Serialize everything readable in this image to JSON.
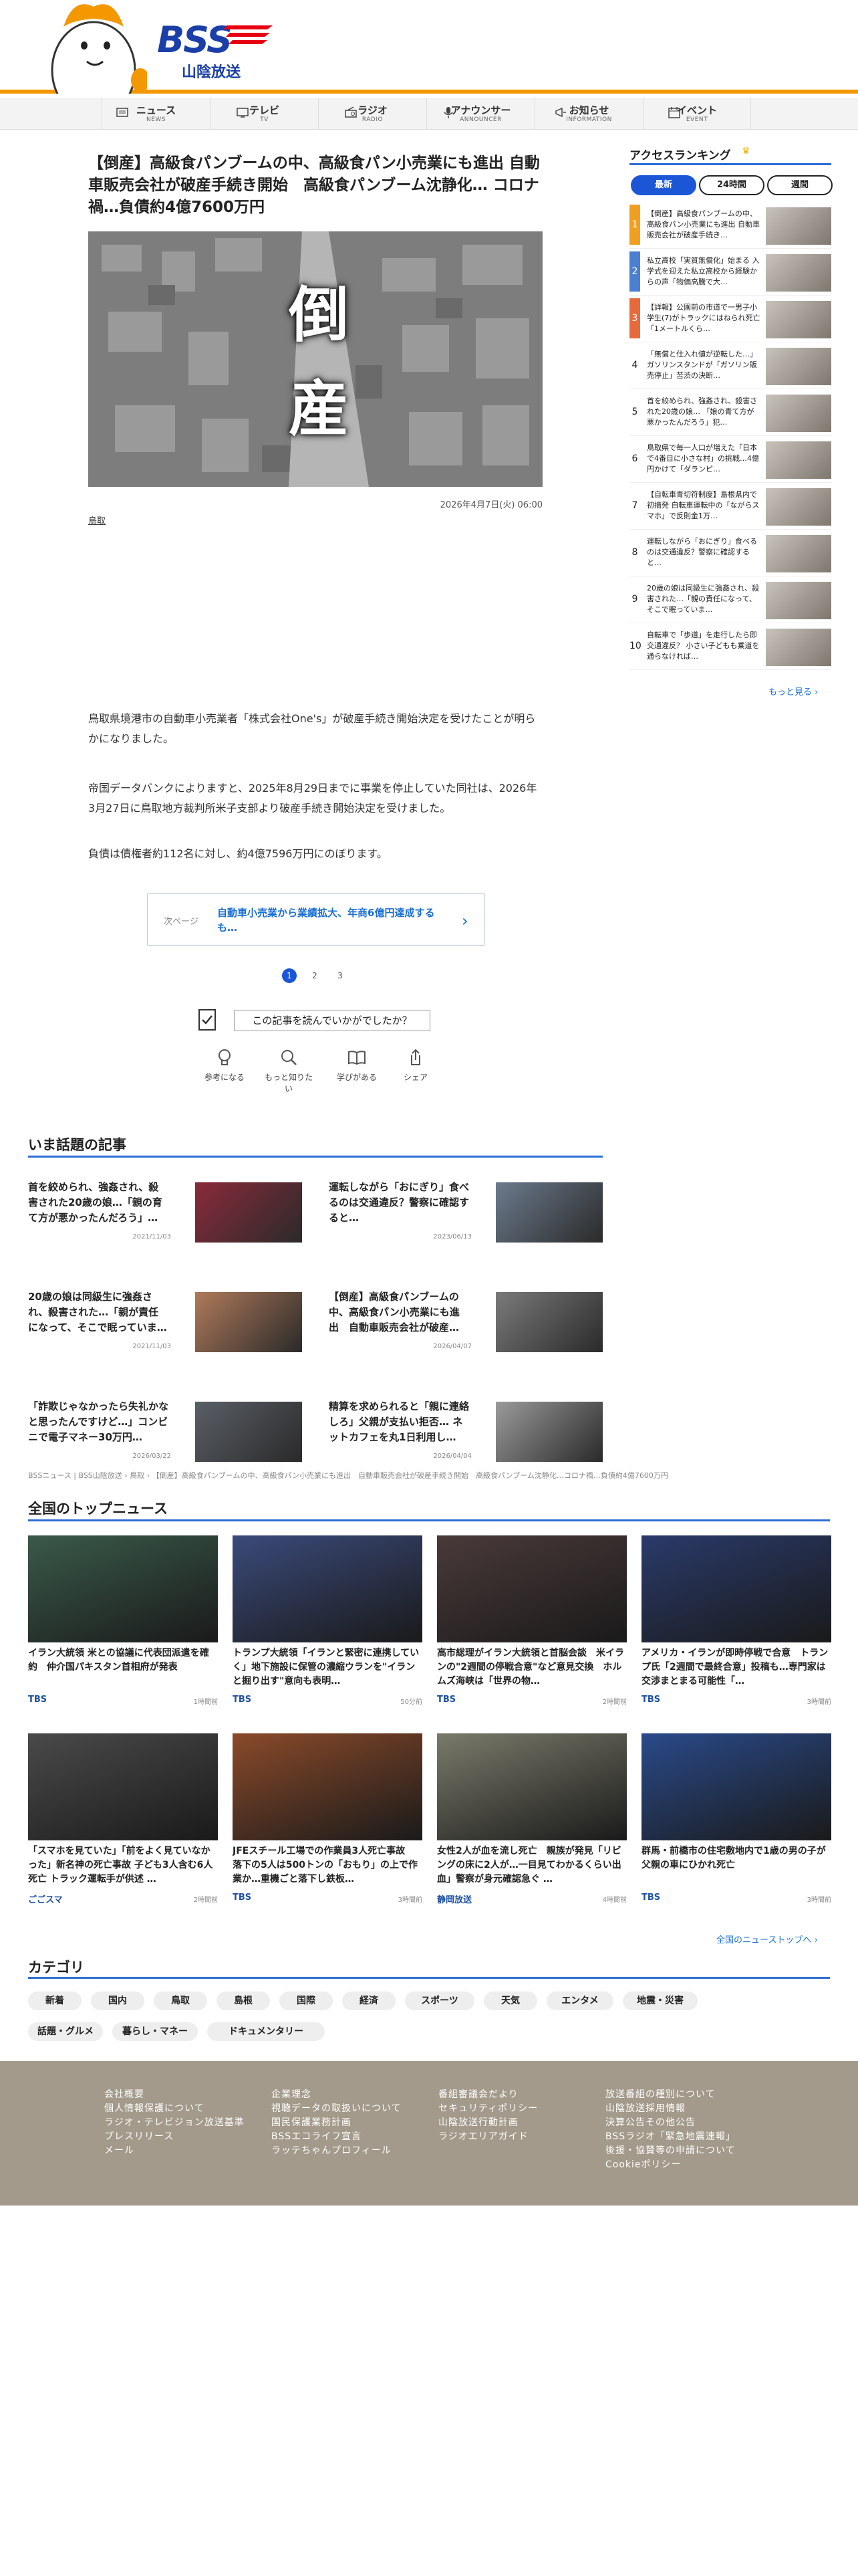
{
  "header": {
    "logo_text": "BSS",
    "logo_subtitle": "山陰放送"
  },
  "nav": [
    {
      "jp": "ニュース",
      "en": "NEWS",
      "icon": "news-icon"
    },
    {
      "jp": "テレビ",
      "en": "TV",
      "icon": "tv-icon"
    },
    {
      "jp": "ラジオ",
      "en": "RADIO",
      "icon": "radio-icon"
    },
    {
      "jp": "アナウンサー",
      "en": "ANNOUNCER",
      "icon": "microphone-icon"
    },
    {
      "jp": "お知らせ",
      "en": "INFORMATION",
      "icon": "megaphone-icon"
    },
    {
      "jp": "イベント",
      "en": "EVENT",
      "icon": "calendar-icon"
    }
  ],
  "article": {
    "title": "【倒産】高級食パンブームの中、高級食パン小売業にも進出 自動車販売会社が破産手続き開始　高級食パンブーム沈静化… コロナ禍…負債約4億7600万円",
    "hero_text_1": "倒",
    "hero_text_2": "産",
    "date": "2026年4月7日(火) 06:00",
    "tag": "鳥取",
    "paragraphs": [
      "鳥取県境港市の自動車小売業者「株式会社One's」が破産手続き開始決定を受けたことが明らかになりました。",
      "帝国データバンクによりますと、2025年8月29日までに事業を停止していた同社は、2026年3月27日に鳥取地方裁判所米子支部より破産手続き開始決定を受けました。",
      "負債は債権者約112名に対し、約4億7596万円にのぼります。"
    ],
    "next_label": "次ページ",
    "next_text": "自動車小売業から業績拡大、年商6億円達成するも…",
    "pages": [
      "1",
      "2",
      "3"
    ],
    "survey_label": "この記事を読んでいかがでしたか？",
    "reactions": [
      {
        "label": "参考になる",
        "icon": "lightbulb-icon"
      },
      {
        "label": "もっと知りたい",
        "icon": "search-icon"
      },
      {
        "label": "学びがある",
        "icon": "book-icon"
      },
      {
        "label": "シェア",
        "icon": "share-icon"
      }
    ]
  },
  "ranking": {
    "title": "アクセスランキング",
    "tabs": [
      "最新",
      "24時間",
      "週間"
    ],
    "items": [
      {
        "num": "1",
        "text": "【倒産】高級食パンブームの中、高級食パン小売業にも進出 自動車販売会社が破産手続き…",
        "accent": "#f0a020"
      },
      {
        "num": "2",
        "text": "私立高校「実質無償化」始まる 入学式を迎えた私立高校から経験からの声「物価高騰で大…",
        "accent": "#4a7fd1"
      },
      {
        "num": "3",
        "text": "【詳報】公園前の市道で一男子小学生(7)がトラックにはねられ死亡 「1メートルくら…",
        "accent": "#e86a3a"
      },
      {
        "num": "4",
        "text": "「無償と仕入れ値が逆転した…」ガソリンスタンドが「ガソリン販売停止」苦渋の決断…",
        "accent": ""
      },
      {
        "num": "5",
        "text": "首を絞められ、強姦され、殺害された20歳の娘… 「娘の青て方が悪かったんだろう」犯…",
        "accent": ""
      },
      {
        "num": "6",
        "text": "鳥取県で毎一人口が増えた「日本で4番目に小さな村」の挑戦…4億円かけて「ダランピ…",
        "accent": ""
      },
      {
        "num": "7",
        "text": "【自転車青切符制度】島根県内で初摘発 自転車運転中の「ながらスマホ」で反則金1万…",
        "accent": ""
      },
      {
        "num": "8",
        "text": "運転しながら「おにぎり」食べるのは交通違反？警察に確認すると…",
        "accent": ""
      },
      {
        "num": "9",
        "text": "20歳の娘は同級生に強姦され、殺害された…「親の責任になって、そこで眠っていま…",
        "accent": ""
      },
      {
        "num": "10",
        "text": "自転車で「歩道」を走行したら即交通違反？ 小さい子どもも乗道を通らなければ…",
        "accent": ""
      }
    ],
    "more": "もっと見る ›"
  },
  "trending": {
    "title": "いま話題の記事",
    "items": [
      {
        "text": "首を絞められ、強姦され、殺害された20歳の娘…「親の育て方が悪かったんだろう」…",
        "date": "2021/11/03",
        "thumb": "#8a2a3a"
      },
      {
        "text": "運転しながら「おにぎり」食べるのは交通違反？警察に確認すると…",
        "date": "2023/06/13",
        "thumb": "#6b7a8c"
      },
      {
        "text": "20歳の娘は同級生に強姦され、殺害された…「親が責任になって、そこで眠っていま…",
        "date": "2021/11/03",
        "thumb": "#b07a5a"
      },
      {
        "text": "【倒産】高級食パンブームの中、高級食パン小売業にも進出　自動車販売会社が破産…",
        "date": "2026/04/07",
        "thumb": "#7a7a7a"
      },
      {
        "text": "「詐欺じゃなかったら失礼かなと思ったんですけど…」コンビニで電子マネー30万円…",
        "date": "2026/03/22",
        "thumb": "#5a5f66"
      },
      {
        "text": "精算を求められると「親に連絡しろ」父親が支払い拒否… ネットカフェを丸1日利用し…",
        "date": "2026/04/04",
        "thumb": "#9a9a9a"
      }
    ]
  },
  "breadcrumb": "BSSニュース | BSS山陰放送 › 鳥取 › 【倒産】高級食パンブームの中、高級食パン小売業にも進出　自動車販売会社が破産手続き開始　高級食パンブーム沈静化…コロナ禍…負債約4億7600万円",
  "national": {
    "title": "全国のトップニュース",
    "items": [
      {
        "text": "イラン大統領 米との協議に代表団派遣を確約　仲介国パキスタン首相府が発表",
        "src": "TBS",
        "time": "1時間前",
        "thumb": "#3a5a4a"
      },
      {
        "text": "トランプ大統領「イランと緊密に連携していく」地下施設に保管の濃縮ウランを\"イランと掘り出す\"意向も表明…",
        "src": "TBS",
        "time": "50分前",
        "thumb": "#3a4a7a"
      },
      {
        "text": "高市総理がイラン大統領と首脳会談　米イランの\"2週間の停戦合意\"など意見交換　ホルムズ海峡は「世界の物…",
        "src": "TBS",
        "time": "2時間前",
        "thumb": "#4a3a3a"
      },
      {
        "text": "アメリカ・イランが即時停戦で合意　トランプ氏「2週間で最終合意」投稿も…専門家は交渉まとまる可能性「…",
        "src": "TBS",
        "time": "3時間前",
        "thumb": "#2a3a6a"
      },
      {
        "text": "「スマホを見ていた」「前をよく見ていなかった」新名神の死亡事故 子ども3人含む6人死亡 トラック運転手が供述 …",
        "src": "ごごスマ",
        "time": "2時間前",
        "thumb": "#4a4a4a"
      },
      {
        "text": "JFEスチール工場での作業員3人死亡事故　落下の5人は500トンの「おもり」の上で作業か…重機ごと落下し鉄板…",
        "src": "TBS",
        "time": "3時間前",
        "thumb": "#8a4a2a"
      },
      {
        "text": "女性2人が血を流し死亡　親族が発見「リビングの床に2人が…一目見てわかるくらい出血」警察が身元確認急ぐ …",
        "src": "静岡放送",
        "time": "4時間前",
        "thumb": "#7a7a6a"
      },
      {
        "text": "群馬・前橋市の住宅敷地内で1歳の男の子が父親の車にひかれ死亡",
        "src": "TBS",
        "time": "3時間前",
        "thumb": "#2a4a8a"
      }
    ],
    "more": "全国のニューストップへ ›"
  },
  "categories": {
    "title": "カテゴリ",
    "items": [
      "新着",
      "国内",
      "鳥取",
      "島根",
      "国際",
      "経済",
      "スポーツ",
      "天気",
      "エンタメ",
      "地震・災害",
      "話題・グルメ",
      "暮らし・マネー",
      "ドキュメンタリー"
    ]
  },
  "footer": {
    "cols": [
      [
        "会社概要",
        "個人情報保護について",
        "ラジオ・テレビジョン放送基準",
        "プレスリリース",
        "メール"
      ],
      [
        "企業理念",
        "視聴データの取扱いについて",
        "国民保護業務計画",
        "BSSエコライフ宣言",
        "ラッテちゃんプロフィール"
      ],
      [
        "番組審議会だより",
        "セキュリティポリシー",
        "山陰放送行動計画",
        "ラジオエリアガイド"
      ],
      [
        "放送番組の種別について",
        "山陰放送採用情報",
        "決算公告その他公告",
        "BSSラジオ「緊急地震速報」",
        "後援・協賛等の申請について",
        "Cookieポリシー"
      ]
    ]
  }
}
